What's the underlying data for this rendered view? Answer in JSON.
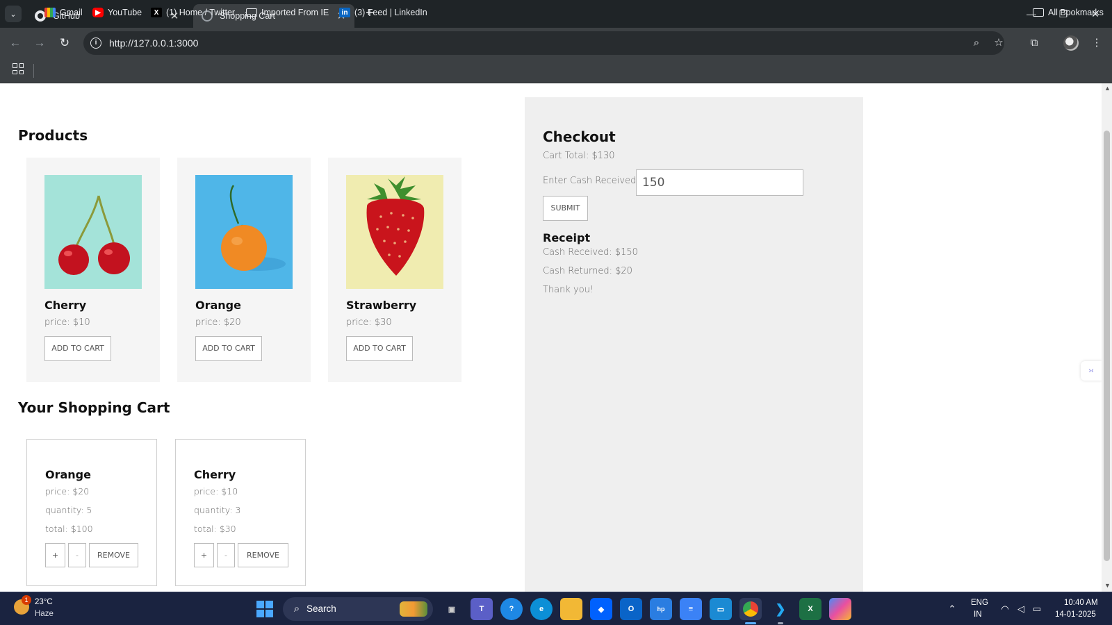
{
  "browser": {
    "tabs": [
      {
        "title": "GitHub",
        "icon": "github-icon"
      },
      {
        "title": "Shopping Cart",
        "icon": "globe-icon"
      }
    ],
    "url": "http://127.0.0.1:3000",
    "bookmarks": [
      {
        "label": "Gmail",
        "icon": "gmail-icon"
      },
      {
        "label": "YouTube",
        "icon": "youtube-icon"
      },
      {
        "label": "(1) Home / Twitter",
        "icon": "x-icon"
      },
      {
        "label": "Imported From IE",
        "icon": "folder-icon"
      },
      {
        "label": "(3) Feed | LinkedIn",
        "icon": "linkedin-icon"
      }
    ],
    "all_bookmarks": "All Bookmarks"
  },
  "products": {
    "heading": "Products",
    "items": [
      {
        "name": "Cherry",
        "price": "price: $10",
        "button": "ADD TO CART",
        "image": "cherry-image"
      },
      {
        "name": "Orange",
        "price": "price: $20",
        "button": "ADD TO CART",
        "image": "orange-image"
      },
      {
        "name": "Strawberry",
        "price": "price: $30",
        "button": "ADD TO CART",
        "image": "strawberry-image"
      }
    ]
  },
  "cart": {
    "heading": "Your Shopping Cart",
    "items": [
      {
        "name": "Orange",
        "price": "price: $20",
        "quantity": "quantity: 5",
        "total": "total: $100",
        "plus": "+",
        "minus": "-",
        "remove": "REMOVE"
      },
      {
        "name": "Cherry",
        "price": "price: $10",
        "quantity": "quantity: 3",
        "total": "total: $30",
        "plus": "+",
        "minus": "-",
        "remove": "REMOVE"
      }
    ]
  },
  "checkout": {
    "heading": "Checkout",
    "cart_total": "Cart Total: $130",
    "cash_label": "Enter Cash Received:",
    "cash_value": "150",
    "submit": "SUBMIT",
    "receipt": {
      "heading": "Receipt",
      "cash_received": "Cash Received: $150",
      "cash_returned": "Cash Returned: $20",
      "message": "Thank you!"
    }
  },
  "taskbar": {
    "weather": {
      "temp": "23°C",
      "condition": "Haze",
      "badge": "1"
    },
    "search_label": "Search",
    "language_line1": "ENG",
    "language_line2": "IN",
    "time": "10:40 AM",
    "date": "14-01-2025"
  },
  "colors": {
    "chrome_dark": "#1f2427",
    "chrome_toolbar": "#3c4043",
    "product_card_bg": "#f5f5f5",
    "checkout_bg": "#efefef",
    "taskbar_bg": "#1a2340"
  }
}
